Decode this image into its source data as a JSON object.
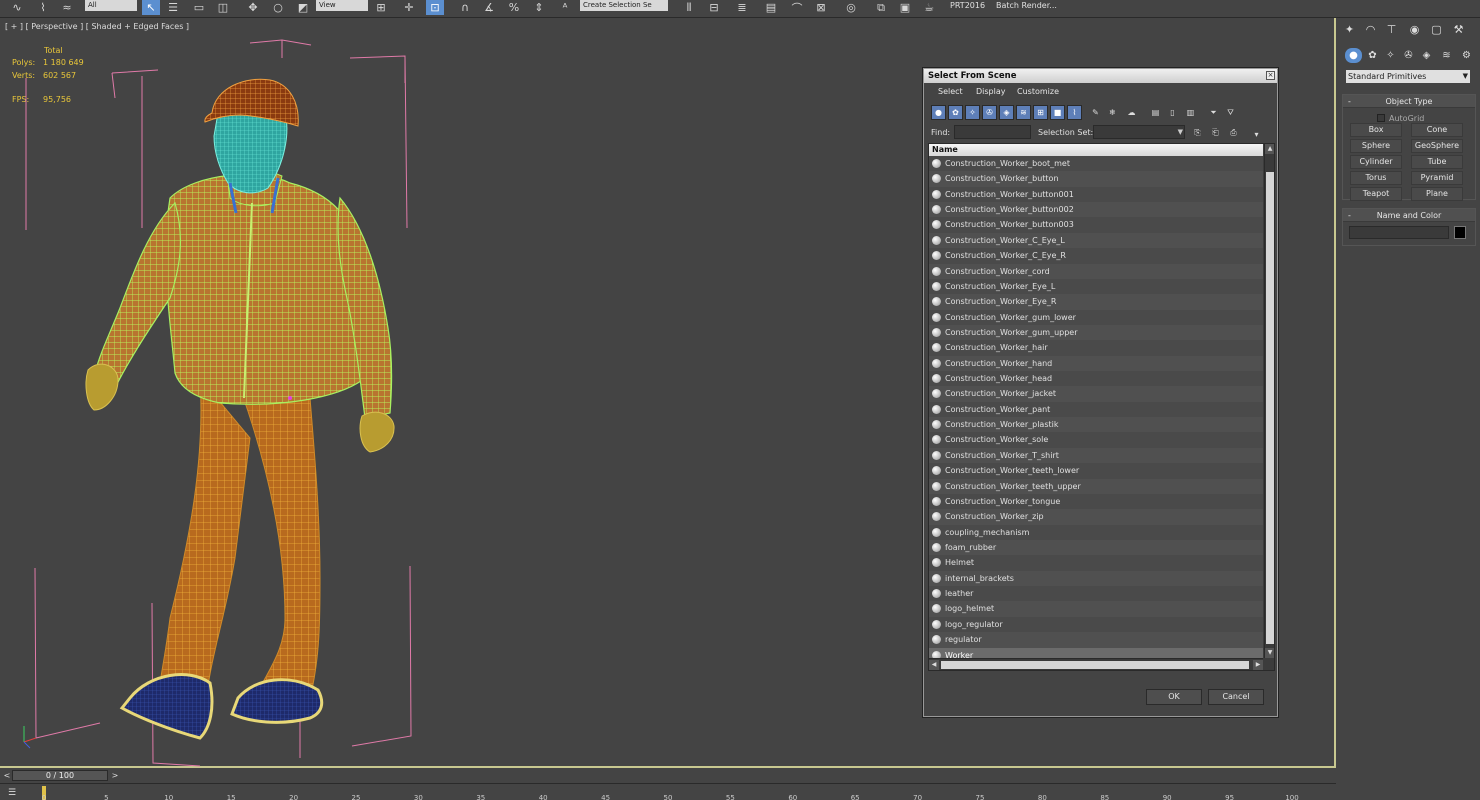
{
  "toolbar": {
    "filter_value": "All",
    "coord_value": "View",
    "selection_set_placeholder": "Create Selection Se",
    "prt_label": "PRT2016",
    "batch_render_label": "Batch Render..."
  },
  "viewport": {
    "label": "[ + ] [ Perspective ] [ Shaded + Edged Faces ]",
    "stats": {
      "header": "Total",
      "polys_label": "Polys:",
      "polys_value": "1 180 649",
      "verts_label": "Verts:",
      "verts_value": "602 567",
      "fps_label": "FPS:",
      "fps_value": "95,756"
    }
  },
  "command_panel": {
    "tab_icons": [
      "create-icon",
      "modify-icon",
      "hierarchy-icon",
      "motion-icon",
      "display-icon",
      "utilities-icon"
    ],
    "category": "Standard Primitives",
    "object_type": {
      "title": "Object Type",
      "autogrid": "AutoGrid",
      "buttons": [
        "Box",
        "Cone",
        "Sphere",
        "GeoSphere",
        "Cylinder",
        "Tube",
        "Torus",
        "Pyramid",
        "Teapot",
        "Plane"
      ]
    },
    "name_color": {
      "title": "Name and Color"
    }
  },
  "dialog": {
    "title": "Select From Scene",
    "close": "×",
    "menu": [
      "Select",
      "Display",
      "Customize"
    ],
    "find_label": "Find:",
    "selection_set_label": "Selection Set:",
    "column_header": "Name",
    "items": [
      "Construction_Worker_boot_met",
      "Construction_Worker_button",
      "Construction_Worker_button001",
      "Construction_Worker_button002",
      "Construction_Worker_button003",
      "Construction_Worker_C_Eye_L",
      "Construction_Worker_C_Eye_R",
      "Construction_Worker_cord",
      "Construction_Worker_Eye_L",
      "Construction_Worker_Eye_R",
      "Construction_Worker_gum_lower",
      "Construction_Worker_gum_upper",
      "Construction_Worker_hair",
      "Construction_Worker_hand",
      "Construction_Worker_head",
      "Construction_Worker_jacket",
      "Construction_Worker_pant",
      "Construction_Worker_plastik",
      "Construction_Worker_sole",
      "Construction_Worker_T_shirt",
      "Construction_Worker_teeth_lower",
      "Construction_Worker_teeth_upper",
      "Construction_Worker_tongue",
      "Construction_Worker_zip",
      "coupling_mechanism",
      "foam_rubber",
      "Helmet",
      "internal_brackets",
      "leather",
      "logo_helmet",
      "logo_regulator",
      "regulator",
      "Worker"
    ],
    "selected_item": "Worker",
    "ok_label": "OK",
    "cancel_label": "Cancel"
  },
  "timeline": {
    "frame_display": "0 / 100",
    "ticks": [
      "0",
      "5",
      "10",
      "15",
      "20",
      "25",
      "30",
      "35",
      "40",
      "45",
      "50",
      "55",
      "60",
      "65",
      "70",
      "75",
      "80",
      "85",
      "90",
      "95",
      "100"
    ]
  },
  "colors": {
    "selection_blue": "#5b8fd0",
    "stats_yellow": "#e8c63a",
    "bbox_pink": "#e07aa8",
    "wire_orange": "#e0a020",
    "wire_green": "#a8f060",
    "viewport_border": "#c8c890"
  }
}
